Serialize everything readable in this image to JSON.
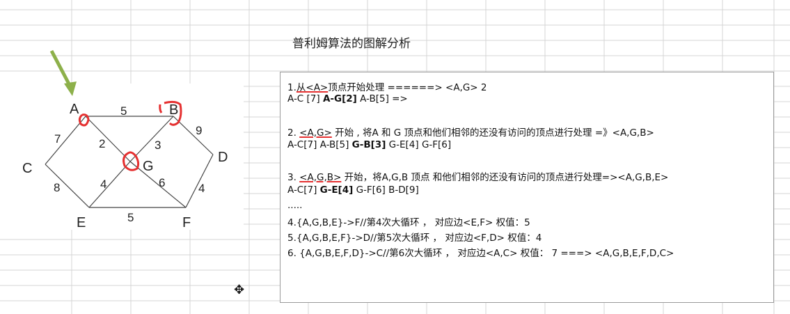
{
  "title": "普利姆算法的图解分析",
  "graph": {
    "nodes": [
      "A",
      "B",
      "C",
      "D",
      "E",
      "F",
      "G"
    ],
    "weights": [
      "5",
      "7",
      "2",
      "3",
      "9",
      "8",
      "4",
      "6",
      "4",
      "5"
    ]
  },
  "steps": [
    {
      "a": "1.",
      "u": "从<A>",
      "b": "顶点开始处理 ======> <A,G> 2"
    },
    {
      "a": "A-C [7] ",
      "bold": "A-G[2]",
      "b": " A-B[5] =>"
    },
    {
      "a": "2. ",
      "u": "<A,G>",
      "b": " 开始 , 将A 和 G 顶点和他们相邻的还没有访问的顶点进行处理 =》<A,G,B>"
    },
    {
      "a": "A-C[7] A-B[5]  ",
      "bold": "G-B[3]",
      "b": " G-E[4] G-F[6]"
    },
    {
      "a": "3. ",
      "u": "<A,G,B>",
      "b": " 开始，将A,G,B 顶点 和他们相邻的还没有访问的顶点进行处理=><A,G,B,E>"
    },
    {
      "a": "A-C[7] ",
      "bold": "G-E[4]",
      "b": " G-F[6] B-D[9]"
    },
    {
      "a": ".....",
      "u": "",
      "b": ""
    },
    {
      "a": "4.{A,G,B,E}->F//第4次大循环 ，  对应边<E,F> 权值：5",
      "u": "",
      "b": ""
    },
    {
      "a": "5.{A,G,B,E,F}->D//第5次大循环 ， 对应边<F,D> 权值：4",
      "u": "",
      "b": ""
    },
    {
      "a": "6. {A,G,B,E,F,D}->C//第6次大循环 ， 对应边<A,C> 权值： 7 ===> <A,G,B,E,F,D,C>",
      "u": "",
      "b": ""
    }
  ],
  "colors": {
    "annotation": "#e53030",
    "arrow": "#8db04a"
  }
}
